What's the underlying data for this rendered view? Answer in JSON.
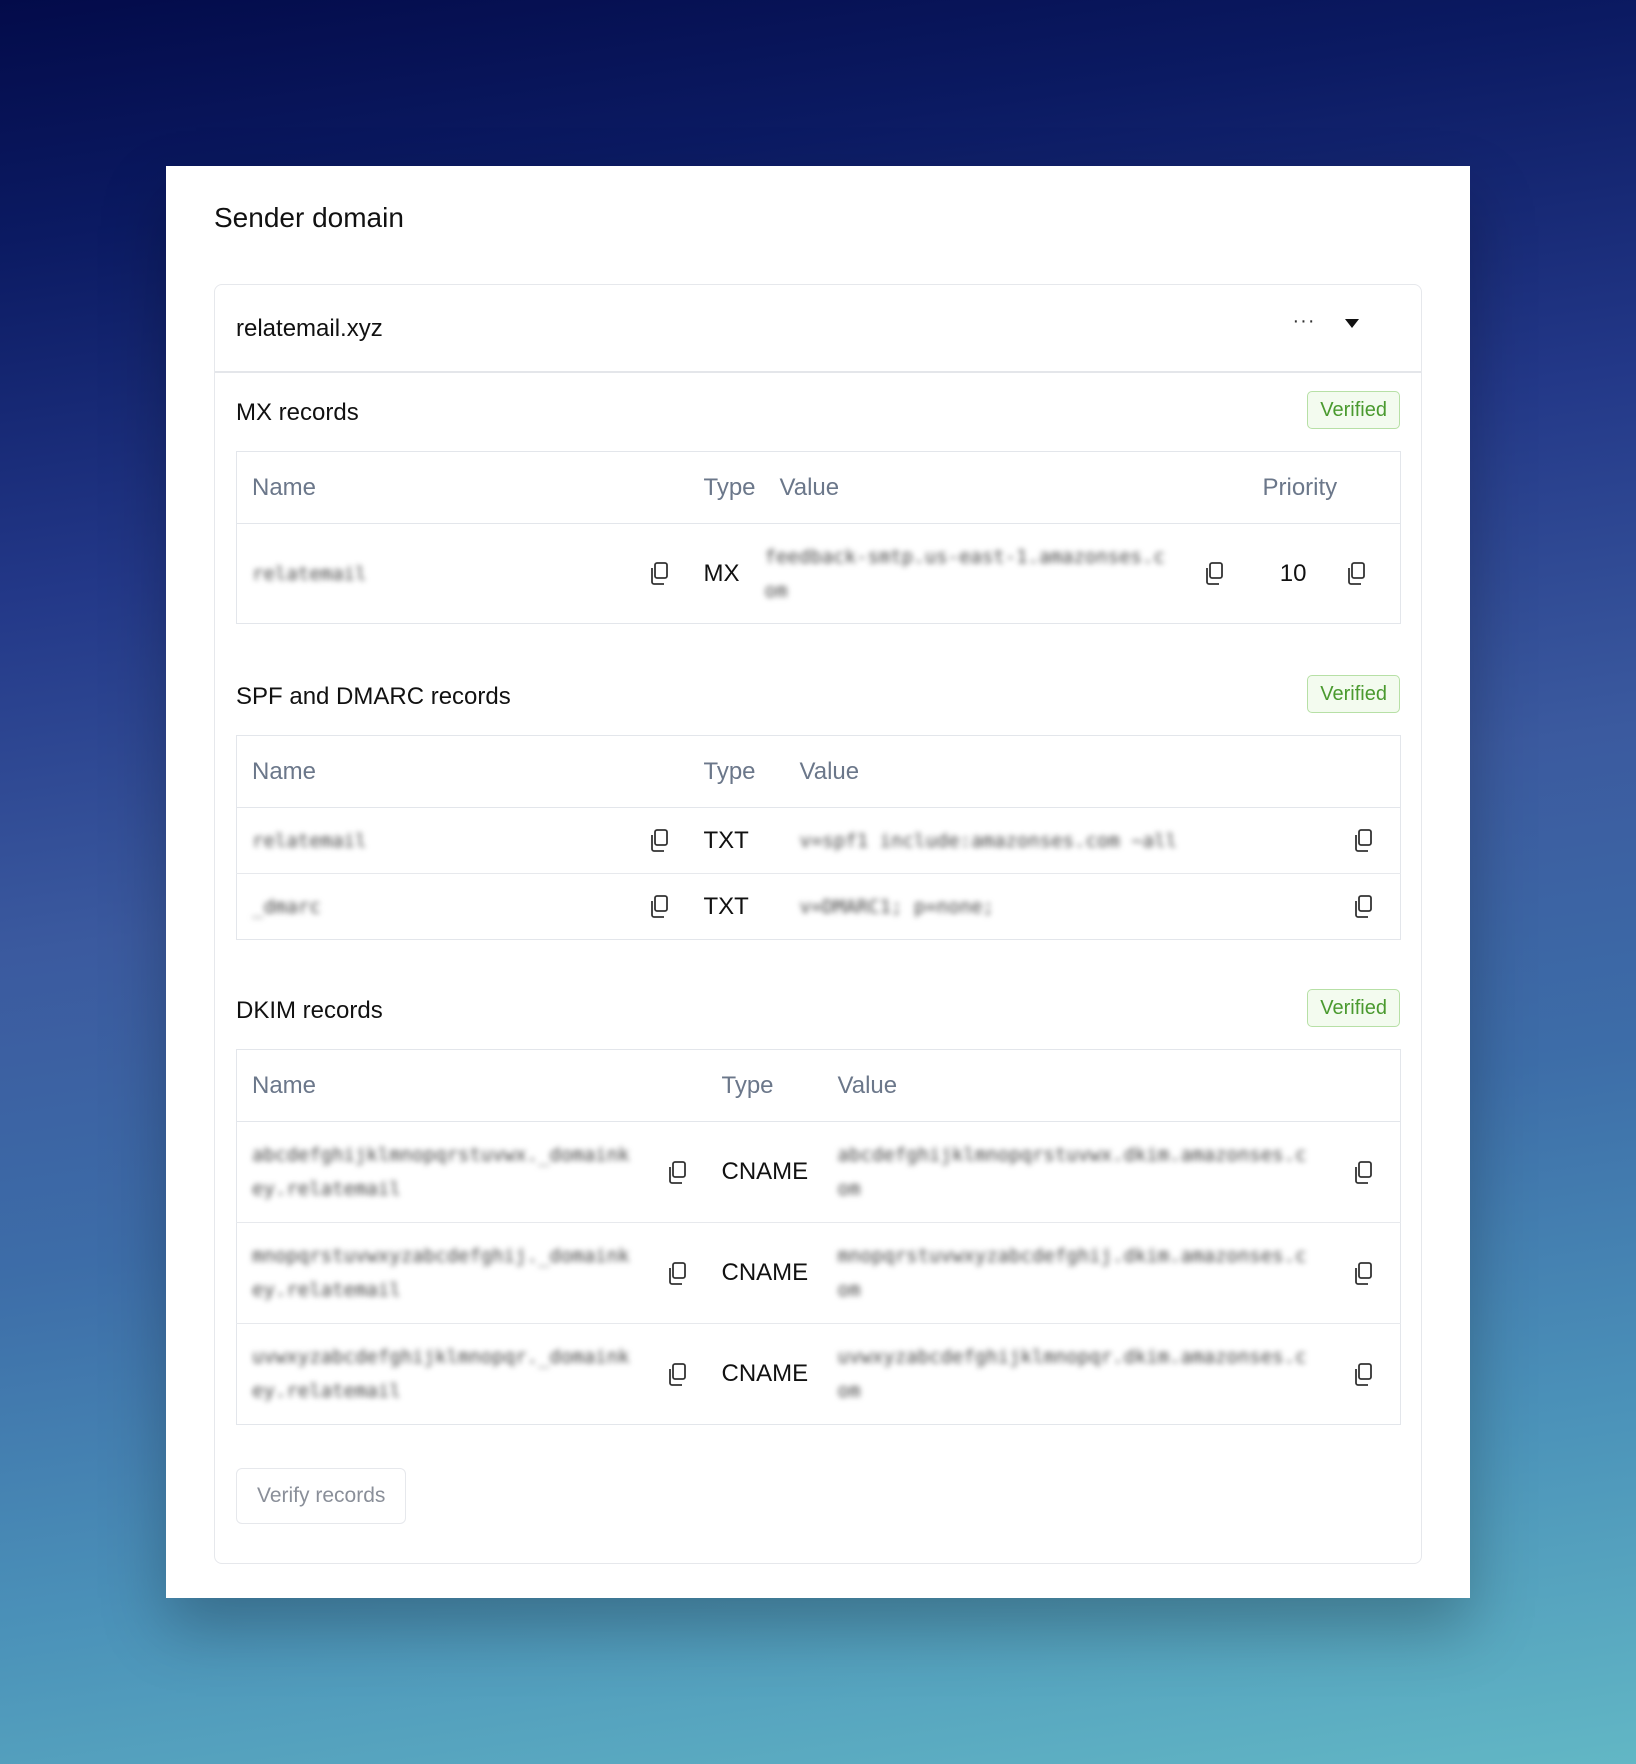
{
  "page_title": "Sender domain",
  "domain": {
    "name": "relatemail.xyz",
    "more_icon": "more-horizontal-icon",
    "expand_icon": "caret-down-icon"
  },
  "sections": {
    "mx": {
      "title": "MX records",
      "status": "Verified",
      "headers": {
        "name": "Name",
        "type": "Type",
        "value": "Value",
        "priority": "Priority"
      },
      "rows": [
        {
          "name": "relatemail",
          "type": "MX",
          "value": "feedback-smtp.us-east-1.amazonses.com",
          "priority": "10"
        }
      ]
    },
    "spf": {
      "title": "SPF and DMARC records",
      "status": "Verified",
      "headers": {
        "name": "Name",
        "type": "Type",
        "value": "Value"
      },
      "rows": [
        {
          "name": "relatemail",
          "type": "TXT",
          "value": "v=spf1 include:amazonses.com ~all"
        },
        {
          "name": "_dmarc",
          "type": "TXT",
          "value": "v=DMARC1; p=none;"
        }
      ]
    },
    "dkim": {
      "title": "DKIM records",
      "status": "Verified",
      "headers": {
        "name": "Name",
        "type": "Type",
        "value": "Value"
      },
      "rows": [
        {
          "name": "abcdefghijklmnopqrstuvwx._domainkey.relatemail",
          "type": "CNAME",
          "value": "abcdefghijklmnopqrstuvwx.dkim.amazonses.com"
        },
        {
          "name": "mnopqrstuvwxyzabcdefghij._domainkey.relatemail",
          "type": "CNAME",
          "value": "mnopqrstuvwxyzabcdefghij.dkim.amazonses.com"
        },
        {
          "name": "uvwxyzabcdefghijklmnopqr._domainkey.relatemail",
          "type": "CNAME",
          "value": "uvwxyzabcdefghijklmnopqr.dkim.amazonses.com"
        }
      ]
    }
  },
  "verify_button": "Verify records",
  "colors": {
    "verified_text": "#4a9a2f",
    "verified_bg": "#f3fbef",
    "verified_border": "#b7e0a6",
    "header_text": "#6b778a"
  }
}
